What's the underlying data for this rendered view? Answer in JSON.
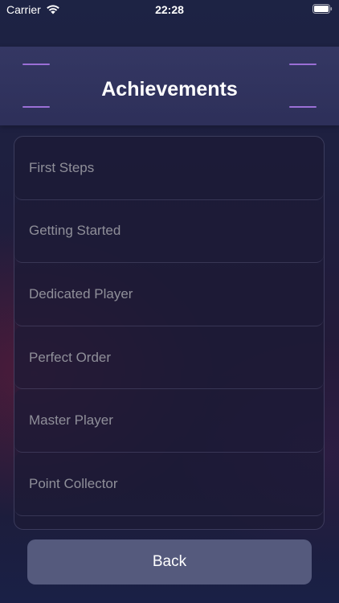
{
  "status_bar": {
    "carrier": "Carrier",
    "time": "22:28"
  },
  "header": {
    "title": "Achievements"
  },
  "achievements": [
    {
      "label": "First Steps"
    },
    {
      "label": "Getting Started"
    },
    {
      "label": "Dedicated Player"
    },
    {
      "label": "Perfect Order"
    },
    {
      "label": "Master Player"
    },
    {
      "label": "Point Collector"
    }
  ],
  "footer": {
    "back_label": "Back"
  },
  "colors": {
    "accent": "#9b6fd6",
    "button": "#555a7d",
    "row_text": "#8f8f99"
  }
}
